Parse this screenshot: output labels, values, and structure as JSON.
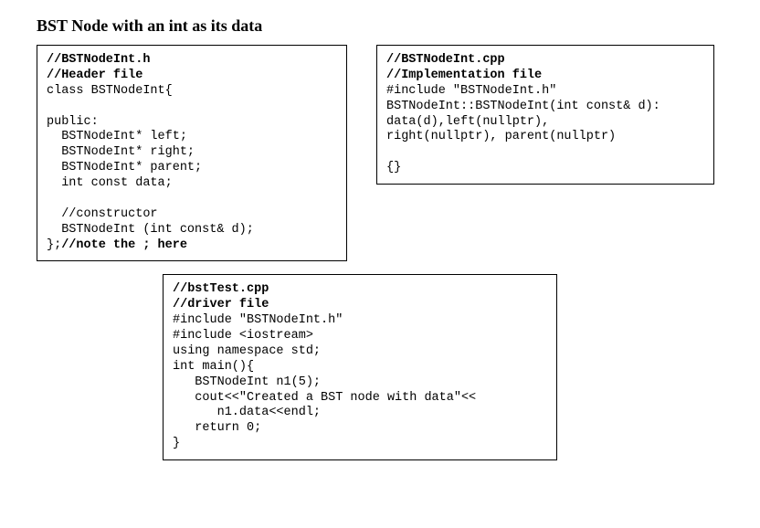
{
  "title": "BST Node with an int as its data",
  "header": {
    "c1": "//BSTNodeInt.h",
    "c2": "//Header file",
    "l1": "class BSTNodeInt{",
    "l2": "",
    "l3": "public:",
    "l4": "  BSTNodeInt* left;",
    "l5": "  BSTNodeInt* right;",
    "l6": "  BSTNodeInt* parent;",
    "l7": "  int const data;",
    "l8": "",
    "l9": "  //constructor",
    "l10": "  BSTNodeInt (int const& d);",
    "l11a": "};",
    "l11b": "//note the ; here"
  },
  "impl": {
    "c1": "//BSTNodeInt.cpp",
    "c2": "//Implementation file",
    "l1": "#include \"BSTNodeInt.h\"",
    "l2": "BSTNodeInt::BSTNodeInt(int const& d):",
    "l3": "data(d),left(nullptr),",
    "l4": "right(nullptr), parent(nullptr)",
    "l5": "",
    "l6": "{}",
    "l7": ""
  },
  "driver": {
    "c1": "//bstTest.cpp",
    "c2": "//driver file",
    "l1": "#include \"BSTNodeInt.h\"",
    "l2": "#include <iostream>",
    "l3": "using namespace std;",
    "l4": "int main(){",
    "l5": "   BSTNodeInt n1(5);",
    "l6": "   cout<<\"Created a BST node with data\"<<",
    "l7": "      n1.data<<endl;",
    "l8": "   return 0;",
    "l9": "}"
  }
}
